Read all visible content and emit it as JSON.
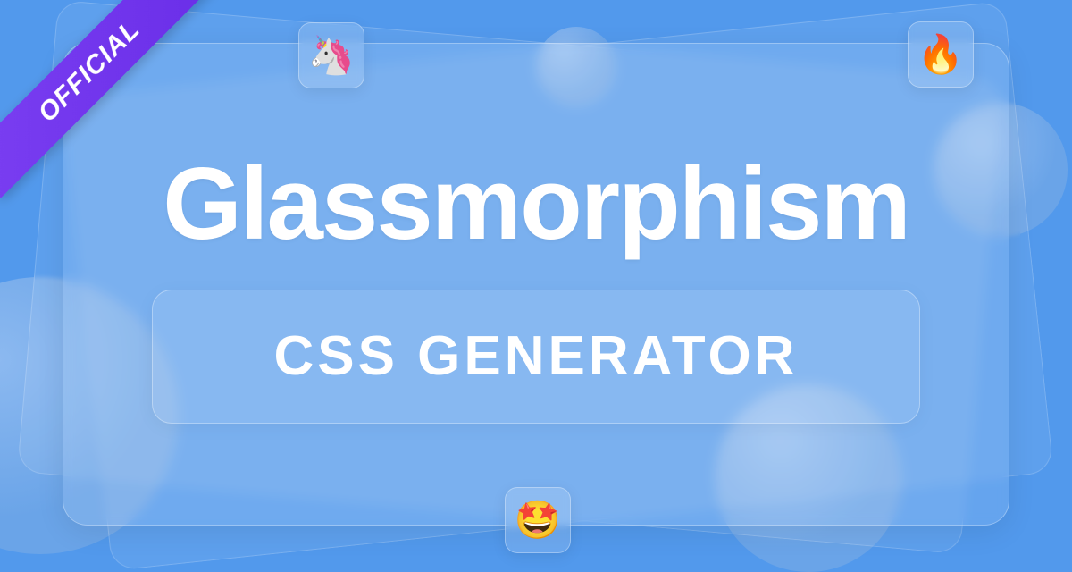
{
  "ribbon": {
    "label": "OFFICIAL"
  },
  "main": {
    "title": "Glassmorphism",
    "subtitle": "CSS GENERATOR"
  },
  "emoji": {
    "unicorn": "🦄",
    "fire": "🔥",
    "starstruck": "🤩"
  }
}
